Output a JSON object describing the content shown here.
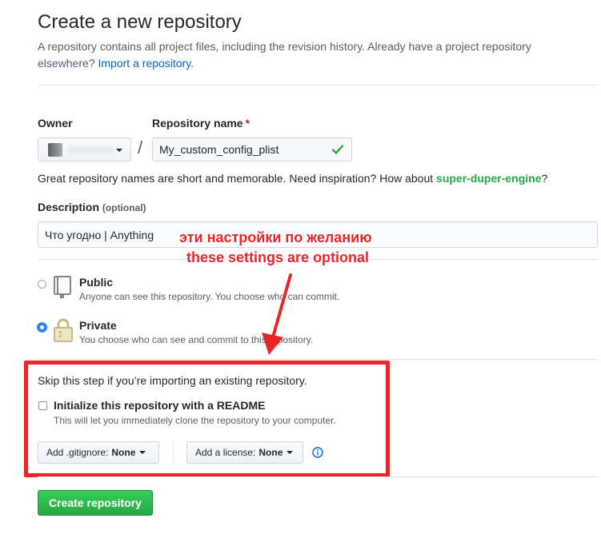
{
  "header": {
    "title": "Create a new repository",
    "subtitle": "A repository contains all project files, including the revision history. Already have a project repository elsewhere?",
    "import_link": "Import a repository."
  },
  "owner": {
    "label": "Owner"
  },
  "repo": {
    "label": "Repository name",
    "required_mark": "*",
    "separator": "/",
    "value": "My_custom_config_plist"
  },
  "hint": {
    "text": "Great repository names are short and memorable. Need inspiration? How about",
    "suggestion": "super-duper-engine",
    "end": "?"
  },
  "description": {
    "label": "Description",
    "optional": "(optional)",
    "value": "Что угодно | Anything"
  },
  "visibility": {
    "public": {
      "title": "Public",
      "note": "Anyone can see this repository. You choose who can commit.",
      "selected": false
    },
    "private": {
      "title": "Private",
      "note": "You choose who can see and commit to this repository.",
      "selected": true
    }
  },
  "init": {
    "skip_text": "Skip this step if you’re importing an existing repository.",
    "readme_label": "Initialize this repository with a README",
    "readme_note": "This will let you immediately clone the repository to your computer.",
    "readme_checked": false,
    "gitignore_prefix": "Add .gitignore:",
    "gitignore_value": "None",
    "license_prefix": "Add a license:",
    "license_value": "None"
  },
  "create_button": "Create repository",
  "annotation": {
    "line_ru": "эти настройки по желанию",
    "line_en": "these settings are optional",
    "color": "#e8262a"
  },
  "colors": {
    "link": "#0366d6",
    "success": "#28a745",
    "required": "#cb2431",
    "radio_selected": "#2f81f7"
  }
}
